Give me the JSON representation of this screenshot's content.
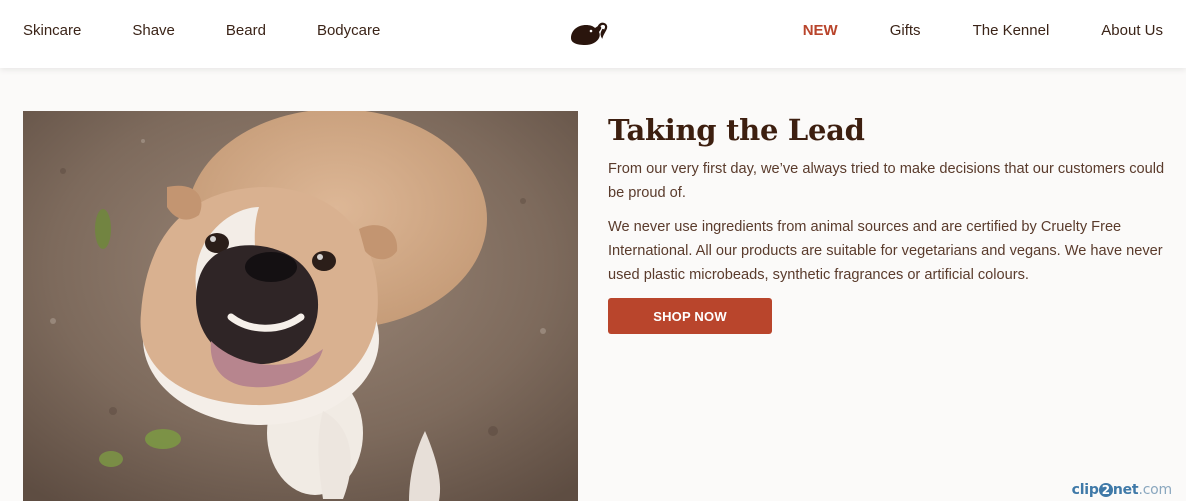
{
  "header": {
    "nav_left": [
      "Skincare",
      "Shave",
      "Beard",
      "Bodycare"
    ],
    "nav_right": [
      "NEW",
      "Gifts",
      "The Kennel",
      "About Us"
    ],
    "logo_icon": "bulldog-logo-icon",
    "new_color": "#b9452c"
  },
  "main": {
    "hero_image": "bulldog-photo",
    "title": "Taking the Lead",
    "paragraph_1": "From our very first day, we’ve always tried to make decisions that our customers could be proud of.",
    "paragraph_2": "We never use ingredients from animal sources and are certified by Cruelty Free International. All our products are suitable for vegetarians and vegans. We have never used plastic microbeads, synthetic fragrances or artificial colours.",
    "cta_label": "SHOP NOW",
    "cta_color": "#b9452c"
  },
  "watermark": {
    "prefix": "clip",
    "mid": "2",
    "name": "net",
    "suffix": ".com"
  }
}
